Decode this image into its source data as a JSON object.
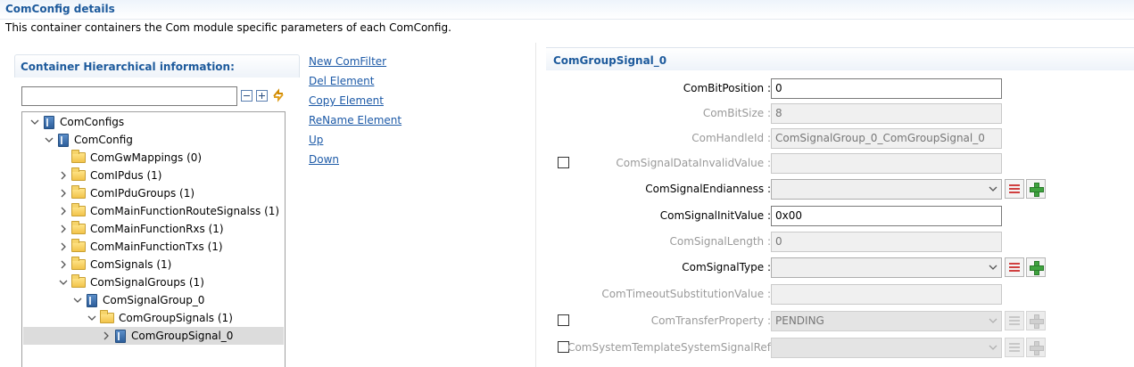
{
  "header": {
    "title": "ComConfig details",
    "description": "This container containers the Com module specific parameters of each ComConfig."
  },
  "left_panel": {
    "title": "Container Hierarchical information:",
    "filter_value": "",
    "tree": [
      {
        "label": "ComConfigs",
        "icon": "container-icon",
        "expanded": true,
        "depth": 0
      },
      {
        "label": "ComConfig",
        "icon": "container-icon",
        "expanded": true,
        "depth": 1
      },
      {
        "label": "ComGwMappings (0)",
        "icon": "folder-icon",
        "expanded": null,
        "depth": 2
      },
      {
        "label": "ComIPdus (1)",
        "icon": "folder-icon",
        "expanded": false,
        "depth": 2
      },
      {
        "label": "ComIPduGroups (1)",
        "icon": "folder-icon",
        "expanded": false,
        "depth": 2
      },
      {
        "label": "ComMainFunctionRouteSignalss (1)",
        "icon": "folder-icon",
        "expanded": false,
        "depth": 2
      },
      {
        "label": "ComMainFunctionRxs (1)",
        "icon": "folder-icon",
        "expanded": false,
        "depth": 2
      },
      {
        "label": "ComMainFunctionTxs (1)",
        "icon": "folder-icon",
        "expanded": false,
        "depth": 2
      },
      {
        "label": "ComSignals (1)",
        "icon": "folder-icon",
        "expanded": false,
        "depth": 2
      },
      {
        "label": "ComSignalGroups (1)",
        "icon": "folder-icon",
        "expanded": true,
        "depth": 2
      },
      {
        "label": "ComSignalGroup_0",
        "icon": "container-icon",
        "expanded": true,
        "depth": 3
      },
      {
        "label": "ComGroupSignals (1)",
        "icon": "folder-icon",
        "expanded": true,
        "depth": 4
      },
      {
        "label": "ComGroupSignal_0",
        "icon": "container-icon",
        "expanded": false,
        "depth": 5,
        "selected": true
      }
    ]
  },
  "actions": [
    "New ComFilter",
    "Del Element",
    "Copy Element",
    "ReName Element",
    "Up",
    "Down"
  ],
  "right_panel": {
    "title": "ComGroupSignal_0",
    "fields": [
      {
        "label": "ComBitPosition :",
        "value": "0",
        "enabled": true,
        "kind": "text",
        "checkbox": false,
        "buttons": false
      },
      {
        "label": "ComBitSize :",
        "value": "8",
        "enabled": false,
        "kind": "text",
        "checkbox": false,
        "buttons": false
      },
      {
        "label": "ComHandleId :",
        "value": "ComSignalGroup_0_ComGroupSignal_0",
        "enabled": false,
        "kind": "text",
        "checkbox": false,
        "buttons": false
      },
      {
        "label": "ComSignalDataInvalidValue :",
        "value": "",
        "enabled": false,
        "kind": "text",
        "checkbox": true,
        "buttons": false
      },
      {
        "label": "ComSignalEndianness :",
        "value": "",
        "enabled": true,
        "kind": "combo",
        "checkbox": false,
        "buttons": true
      },
      {
        "label": "ComSignalInitValue :",
        "value": "0x00",
        "enabled": true,
        "kind": "text",
        "checkbox": false,
        "buttons": false
      },
      {
        "label": "ComSignalLength :",
        "value": "0",
        "enabled": false,
        "kind": "text",
        "checkbox": false,
        "buttons": false
      },
      {
        "label": "ComSignalType :",
        "value": "",
        "enabled": true,
        "kind": "combo",
        "checkbox": false,
        "buttons": true
      },
      {
        "label": "ComTimeoutSubstitutionValue :",
        "value": "",
        "enabled": false,
        "kind": "text",
        "checkbox": false,
        "buttons": false
      },
      {
        "label": "ComTransferProperty :",
        "value": "PENDING",
        "enabled": false,
        "kind": "combo",
        "checkbox": true,
        "buttons": true
      },
      {
        "label": "ComSystemTemplateSystemSignalRef",
        "value": "",
        "enabled": false,
        "kind": "combo",
        "checkbox": true,
        "buttons": true
      }
    ]
  },
  "colors": {
    "heading": "#1d5a9c",
    "link": "#1d5aa7",
    "selection": "#dcdcdc",
    "disabled_text": "#9a9a9a",
    "add_icon": "#3fa33f",
    "list_icon": "#d04040"
  }
}
